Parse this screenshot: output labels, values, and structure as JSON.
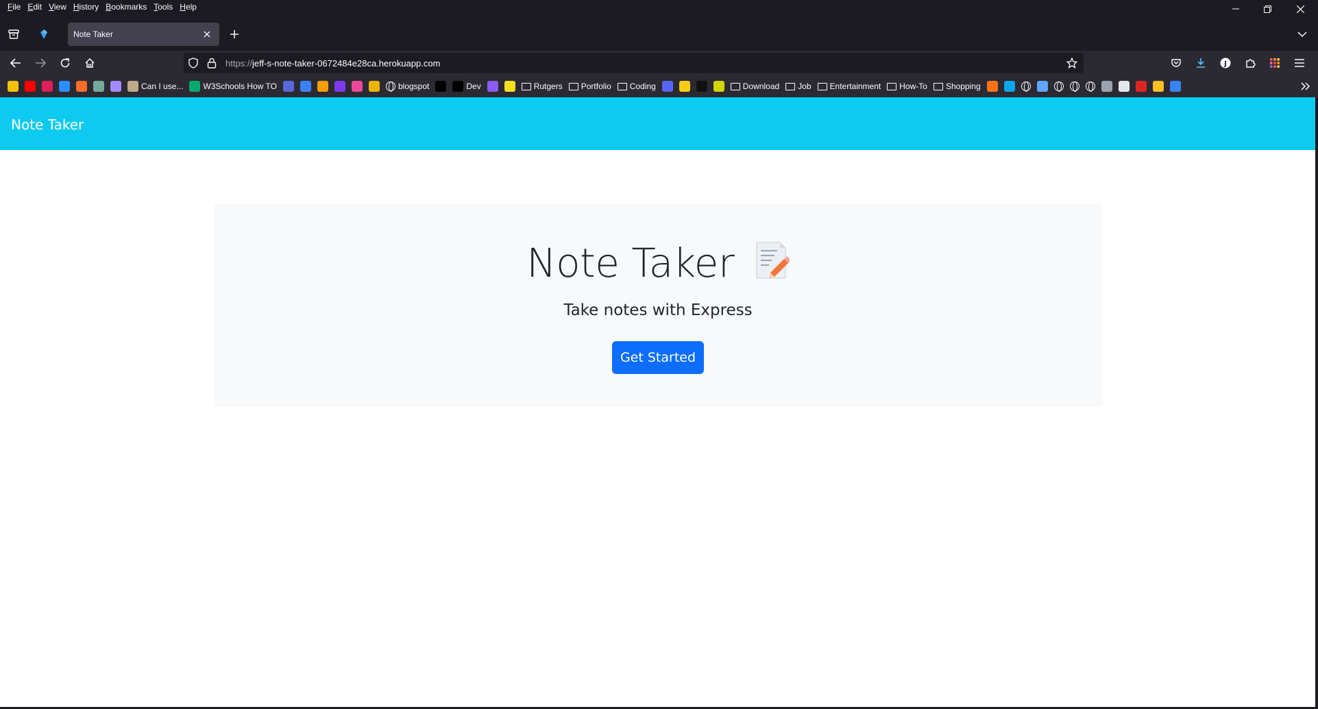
{
  "menubar": {
    "items": [
      "File",
      "Edit",
      "View",
      "History",
      "Bookmarks",
      "Tools",
      "Help"
    ]
  },
  "tabs": [
    {
      "title": "Note Taker",
      "active": true
    }
  ],
  "navbar": {
    "url_scheme": "https://",
    "url_host": "jeff-s-note-taker-0672484e28ca.herokuapp.com"
  },
  "bookmarks": [
    {
      "label": "",
      "icon": "yellow-app-icon",
      "color": "#f4c20d"
    },
    {
      "label": "",
      "icon": "youtube-icon",
      "color": "#ff0000"
    },
    {
      "label": "",
      "icon": "slack-icon",
      "color": "#e01e5a"
    },
    {
      "label": "",
      "icon": "z-icon",
      "color": "#2d8cff"
    },
    {
      "label": "",
      "icon": "gitlab-icon",
      "color": "#fc6d26"
    },
    {
      "label": "",
      "icon": "chatgpt-icon",
      "color": "#74aa9c"
    },
    {
      "label": "",
      "icon": "sparkle-icon",
      "color": "#a58bff"
    },
    {
      "label": "Can I use...",
      "icon": "caniuse-icon",
      "color": "#bfa98a"
    },
    {
      "label": "W3Schools How TO",
      "icon": "w3schools-icon",
      "color": "#04aa6d"
    },
    {
      "label": "",
      "icon": "s-icon",
      "color": "#5a67d8"
    },
    {
      "label": "",
      "icon": "wave-icon",
      "color": "#3b82f6"
    },
    {
      "label": "",
      "icon": "shield-icon",
      "color": "#f59e0b"
    },
    {
      "label": "",
      "icon": "b-icon",
      "color": "#7c3aed"
    },
    {
      "label": "",
      "icon": "m-icon",
      "color": "#ec4899"
    },
    {
      "label": "",
      "icon": "pen-icon",
      "color": "#eab308"
    },
    {
      "label": "blogspot",
      "icon": "globe-icon",
      "color": ""
    },
    {
      "label": "",
      "icon": "github-icon",
      "color": "#000000"
    },
    {
      "label": "Dev",
      "icon": "github-icon",
      "color": "#000000"
    },
    {
      "label": "",
      "icon": "h-icon",
      "color": "#8b5cf6"
    },
    {
      "label": "",
      "icon": "js-icon",
      "color": "#f7df1e"
    },
    {
      "label": "Rutgers",
      "icon": "folder-icon",
      "color": ""
    },
    {
      "label": "Portfolio",
      "icon": "folder-icon",
      "color": ""
    },
    {
      "label": "Coding",
      "icon": "folder-icon",
      "color": ""
    },
    {
      "label": "",
      "icon": "discord-icon",
      "color": "#5865f2"
    },
    {
      "label": "",
      "icon": "card-icon",
      "color": "#facc15"
    },
    {
      "label": "",
      "icon": "s-black-icon",
      "color": "#111111"
    },
    {
      "label": "",
      "icon": "grid-icon",
      "color": "#d4d400"
    },
    {
      "label": "Download",
      "icon": "folder-icon",
      "color": ""
    },
    {
      "label": "Job",
      "icon": "folder-icon",
      "color": ""
    },
    {
      "label": "Entertainment",
      "icon": "folder-icon",
      "color": ""
    },
    {
      "label": "How-To",
      "icon": "folder-icon",
      "color": ""
    },
    {
      "label": "Shopping",
      "icon": "folder-icon",
      "color": ""
    },
    {
      "label": "",
      "icon": "circle-icon",
      "color": "#f97316"
    },
    {
      "label": "",
      "icon": "cloud-icon",
      "color": "#0ea5e9"
    },
    {
      "label": "",
      "icon": "globe-icon",
      "color": ""
    },
    {
      "label": "",
      "icon": "badge-icon",
      "color": "#60a5fa"
    },
    {
      "label": "",
      "icon": "globe-icon",
      "color": ""
    },
    {
      "label": "",
      "icon": "globe-icon",
      "color": ""
    },
    {
      "label": "",
      "icon": "globe-icon",
      "color": ""
    },
    {
      "label": "",
      "icon": "dot-icon",
      "color": "#9ca3af"
    },
    {
      "label": "",
      "icon": "steam-icon",
      "color": "#e5e7eb"
    },
    {
      "label": "",
      "icon": "red-app-icon",
      "color": "#dc2626"
    },
    {
      "label": "",
      "icon": "star-app-icon",
      "color": "#fbbf24"
    },
    {
      "label": "",
      "icon": "q-icon",
      "color": "#3b82f6"
    }
  ],
  "page": {
    "brand": "Note Taker",
    "title": "Note Taker",
    "lead": "Take notes with Express",
    "cta": "Get Started"
  },
  "colors": {
    "navbar_bg": "#0dcaf0",
    "primary": "#0d6efd",
    "jumbotron_bg": "#f8f9fa"
  }
}
